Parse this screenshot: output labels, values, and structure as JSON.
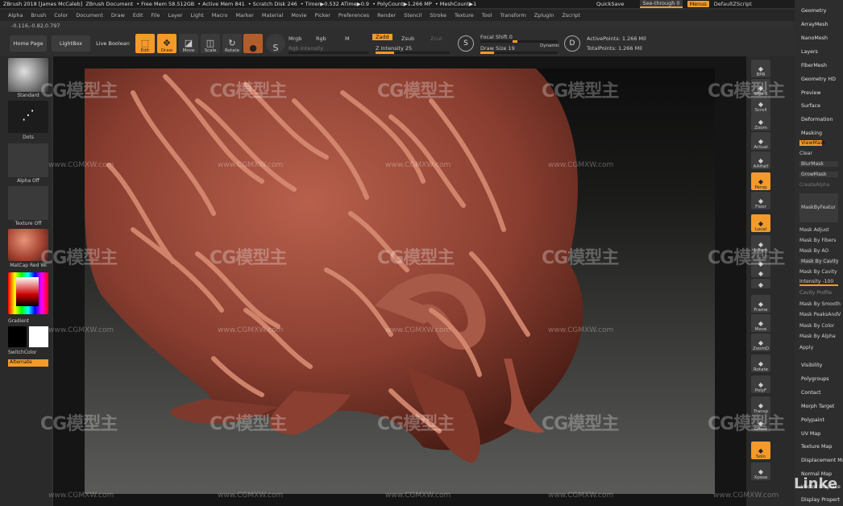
{
  "titlebar": {
    "app": "ZBrush 2018 [James McCaleb]",
    "document": "ZBrush Document",
    "free_mem": "• Free Mem 58.512GB",
    "active_mem": "• Active Mem 841",
    "scratch": "• Scratch Disk 246",
    "timer": "• Timer▶0.532 ATime▶0.9",
    "polycount": "• PolyCount▶1.266 MP",
    "meshcount": "• MeshCount▶1",
    "quicksave": "QuickSave",
    "seethrough": "See-through  0",
    "menus": "Menus",
    "script": "DefaultZScript"
  },
  "menubar": [
    "Alpha",
    "Brush",
    "Color",
    "Document",
    "Draw",
    "Edit",
    "File",
    "Layer",
    "Light",
    "Macro",
    "Marker",
    "Material",
    "Movie",
    "Picker",
    "Preferences",
    "Render",
    "Stencil",
    "Stroke",
    "Texture",
    "Tool",
    "Transform",
    "Zplugin",
    "Zscript"
  ],
  "coords": "-0.116,-0.82,0.797",
  "toolbar": {
    "home_page": "Home Page",
    "lightbox": "LightBox",
    "live_boolean": "Live Boolean",
    "edit": "Edit",
    "draw": "Draw",
    "move": "Move",
    "scale": "Scale",
    "rotate": "Rotate",
    "mrgb": "Mrgb",
    "rgb": "Rgb",
    "m": "M",
    "rgb_intensity": "Rgb Intensity",
    "zadd": "Zadd",
    "zsub": "Zsub",
    "zcut": "Zcut",
    "z_intensity": "Z Intensity 25",
    "focal_shift": "Focal Shift 0",
    "draw_size": "Draw Size 19",
    "dynamic": "Dynamic",
    "active_points": "ActivePoints: 1.266 Mil",
    "total_points": "TotalPoints: 1.266 Mil",
    "s_letter": "S",
    "d_letter": "D"
  },
  "leftpanel": {
    "standard": "Standard",
    "dots": "Dots",
    "alpha_off": "Alpha Off",
    "texture_off": "Texture Off",
    "matcap": "MatCap Red Wi",
    "gradient": "Gradient",
    "switchcolor": "SwitchColor",
    "alternate": "Alternate"
  },
  "shelf": [
    "BPR",
    "SPix 3",
    "Scroll",
    "Zoom",
    "Actual",
    "AAHalf",
    "Persp",
    "Floor",
    "Local",
    "L.Sym",
    "XYZ",
    "",
    "",
    "Frame",
    "Move",
    "ZoomD",
    "Rotate",
    "PolyF",
    "Transp",
    "Ghost",
    "Solo",
    "Xpose"
  ],
  "tray_top": [
    "Geometry",
    "ArrayMesh",
    "NanoMesh",
    "Layers",
    "FiberMesh",
    "Geometry HD",
    "Preview",
    "Surface",
    "Deformation",
    "Masking"
  ],
  "masking": {
    "viewmask": "ViewMask",
    "clear": "Clear",
    "blurmask": "BlurMask",
    "growmask": "GrowMask",
    "createalpha": "CreateAlpha",
    "maskbyfeature": "MaskByFeatur",
    "items": [
      "Mask Adjust",
      "Mask By Fibers",
      "Mask By AO",
      "Mask By Cavity",
      "Mask By Cavity",
      "Intensity -100",
      "Cavity Profile",
      "Mask By Smooth",
      "Mask PeaksAndV",
      "Mask By Color",
      "Mask By Alpha",
      "Apply"
    ]
  },
  "tray_bottom": [
    "Visibility",
    "Polygroups",
    "Contact",
    "Morph Target",
    "Polypaint",
    "UV Map",
    "Texture Map",
    "Displacement Map",
    "Normal Map",
    "Vector Displace",
    "Display Propert"
  ],
  "watermark": {
    "text": "CG模型主",
    "url": "www.CGMXW.com",
    "corner": "Linke"
  },
  "colors": {
    "accent": "#f39a2a",
    "clay": "#9c4d3f",
    "clay_light": "#d98c74"
  }
}
